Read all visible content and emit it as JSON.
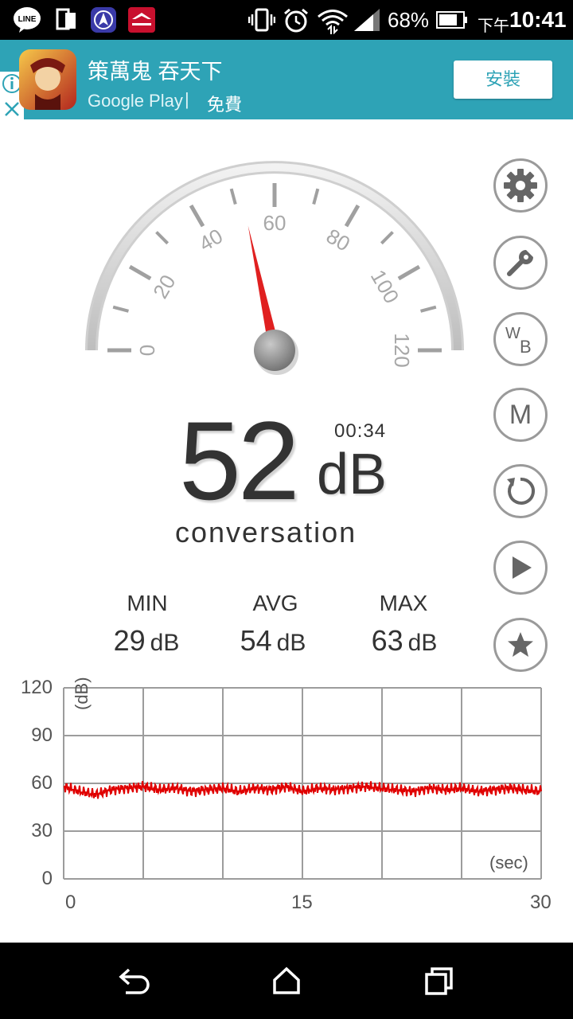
{
  "status_bar": {
    "battery_percent": "68%",
    "ampm": "下午",
    "time": "10:41",
    "icons": [
      "line-app-icon",
      "multi-window-icon",
      "navigation-app-icon",
      "capital-app-icon",
      "vibrate-icon",
      "alarm-icon",
      "wifi-icon",
      "signal-icon",
      "battery-icon"
    ]
  },
  "ad": {
    "title": "策萬鬼 吞天下",
    "store": "Google Play",
    "separator": "|",
    "price": "免費",
    "install_label": "安裝",
    "colors": {
      "background": "#2ea3b6"
    }
  },
  "gauge": {
    "ticks": [
      "0",
      "20",
      "40",
      "60",
      "80",
      "100",
      "120"
    ],
    "min": 0,
    "max": 120,
    "needle_value": 52,
    "needle_color": "#e02020"
  },
  "readout": {
    "value": "52",
    "unit": "dB",
    "timer": "00:34",
    "level_description": "conversation"
  },
  "stats": {
    "min_label": "MIN",
    "min_value": "29",
    "min_unit": "dB",
    "avg_label": "AVG",
    "avg_value": "54",
    "avg_unit": "dB",
    "max_label": "MAX",
    "max_value": "63",
    "max_unit": "dB"
  },
  "side_buttons": [
    {
      "name": "settings",
      "icon": "gear-icon"
    },
    {
      "name": "tools",
      "icon": "wrench-icon"
    },
    {
      "name": "white-balance",
      "icon": "wb-icon",
      "label_w": "W",
      "label_b": "B"
    },
    {
      "name": "memory",
      "icon": "m-icon",
      "label": "M"
    },
    {
      "name": "reset",
      "icon": "refresh-icon"
    },
    {
      "name": "play",
      "icon": "play-icon"
    },
    {
      "name": "favorite",
      "icon": "star-icon"
    }
  ],
  "chart_data": {
    "type": "line",
    "ylabel": "(dB)",
    "xlabel": "(sec)",
    "ylim": [
      0,
      120
    ],
    "xlim": [
      0,
      30
    ],
    "y_ticks": [
      "120",
      "90",
      "60",
      "30",
      "0"
    ],
    "x_ticks": [
      "0",
      "15",
      "30"
    ],
    "grid": true,
    "series_color": "#e00000",
    "series": [
      {
        "x": [
          0,
          1,
          2,
          3,
          4,
          5,
          6,
          7,
          8,
          9,
          10,
          11,
          12,
          13,
          14,
          15,
          16,
          17,
          18,
          19,
          20,
          21,
          22,
          23,
          24,
          25,
          26,
          27,
          28,
          29,
          30
        ],
        "values": [
          58,
          55,
          53,
          56,
          57,
          58,
          56,
          57,
          55,
          56,
          57,
          55,
          57,
          56,
          58,
          55,
          57,
          56,
          57,
          58,
          57,
          56,
          55,
          57,
          56,
          57,
          55,
          56,
          57,
          56,
          55
        ]
      }
    ]
  },
  "colors": {
    "accent": "#e02020",
    "navbar": "#000000"
  }
}
